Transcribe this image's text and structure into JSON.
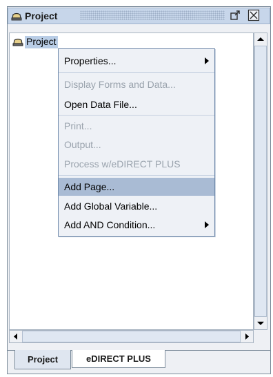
{
  "window": {
    "title": "Project"
  },
  "tree": {
    "root_label": "Project"
  },
  "context_menu": {
    "items": [
      {
        "label": "Properties...",
        "enabled": true,
        "submenu": true
      },
      {
        "label": "Display Forms and Data...",
        "enabled": false,
        "submenu": false
      },
      {
        "label": "Open Data File...",
        "enabled": true,
        "submenu": false
      },
      {
        "label": "Print...",
        "enabled": false,
        "submenu": false
      },
      {
        "label": "Output...",
        "enabled": false,
        "submenu": false
      },
      {
        "label": "Process w/eDIRECT PLUS",
        "enabled": false,
        "submenu": false
      },
      {
        "label": "Add Page...",
        "enabled": true,
        "submenu": false,
        "highlighted": true
      },
      {
        "label": "Add Global Variable...",
        "enabled": true,
        "submenu": false
      },
      {
        "label": "Add AND Condition...",
        "enabled": true,
        "submenu": true
      }
    ]
  },
  "tabs": [
    {
      "label": "Project",
      "active": true
    },
    {
      "label": "eDIRECT PLUS",
      "active": false
    }
  ],
  "colors": {
    "title_bar": "#c7d6ea",
    "menu_highlight": "#a9bbd4",
    "tree_selection": "#b9cde6",
    "disabled_text": "#9aa3ad"
  }
}
